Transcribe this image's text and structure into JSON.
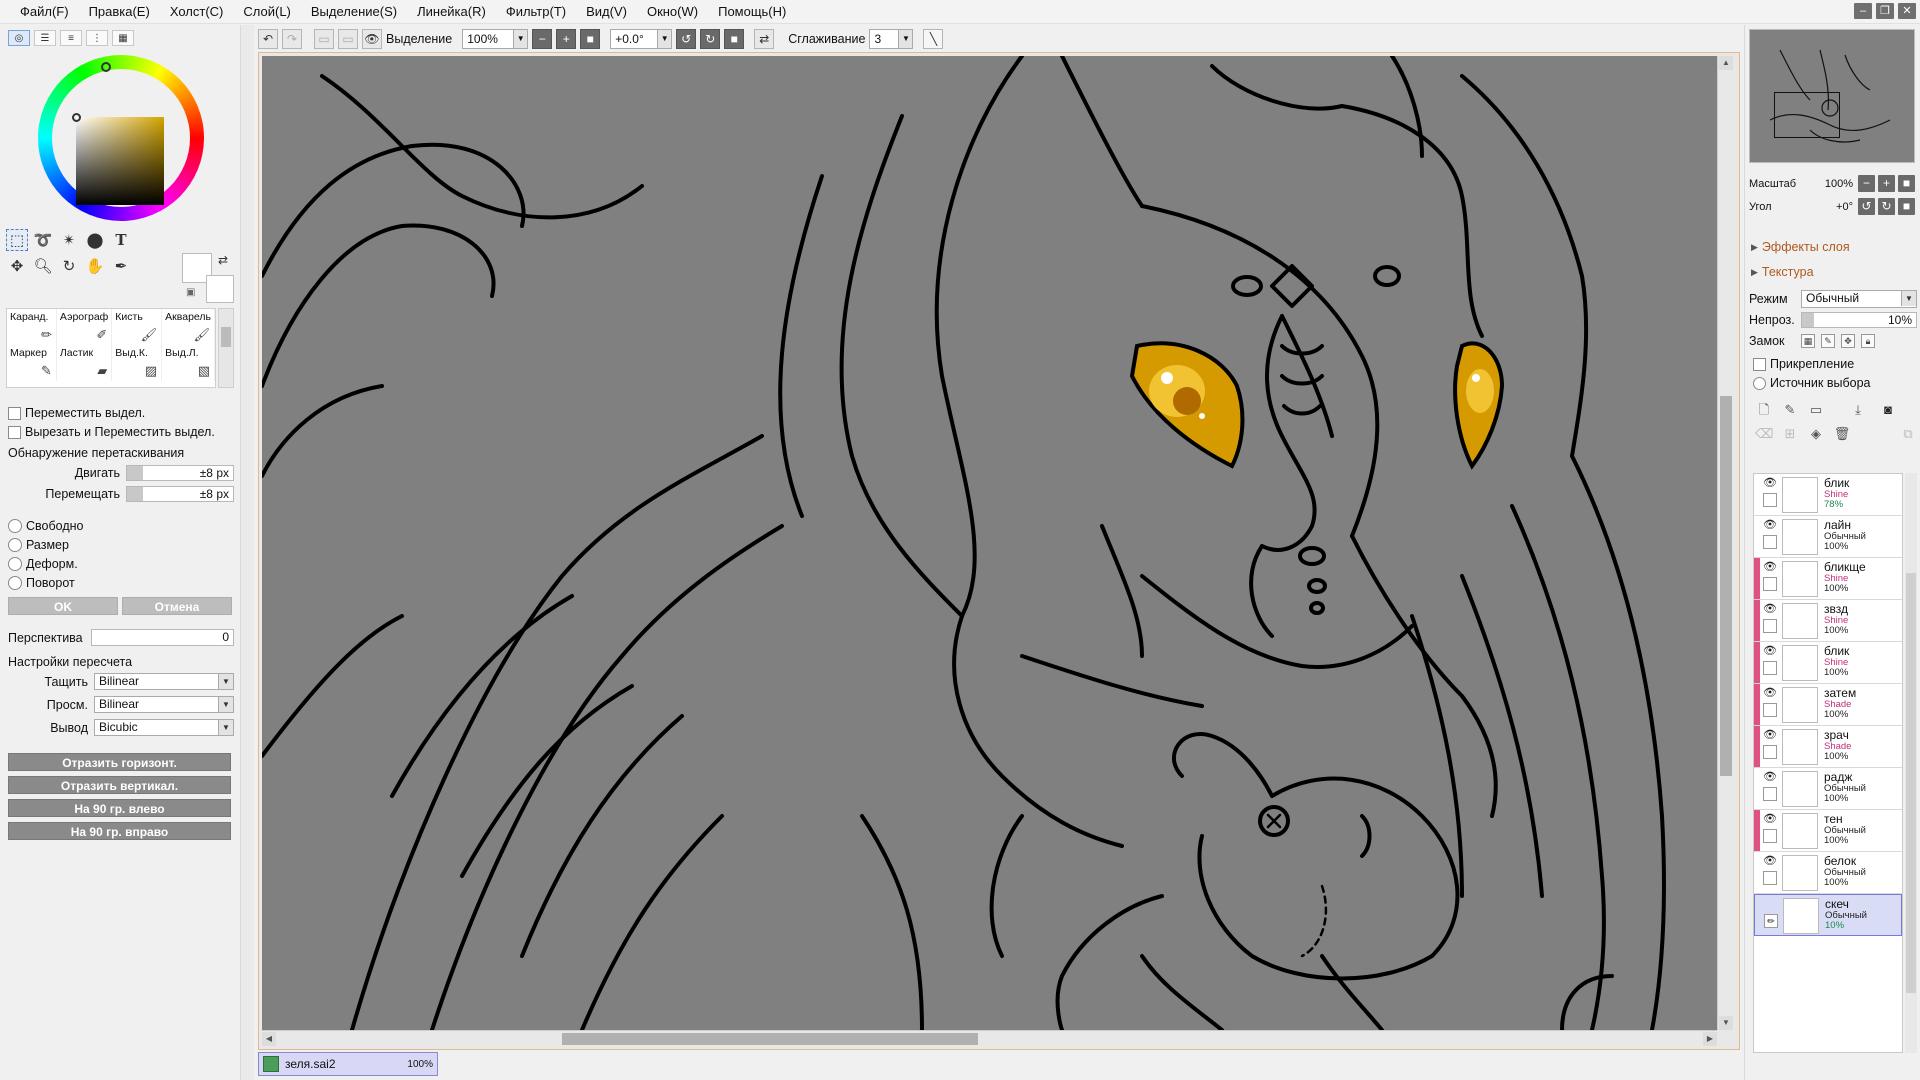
{
  "menubar": {
    "items": [
      "Файл(F)",
      "Правка(E)",
      "Холст(C)",
      "Слой(L)",
      "Выделение(S)",
      "Линейка(R)",
      "Фильтр(T)",
      "Вид(V)",
      "Окно(W)",
      "Помощь(H)"
    ]
  },
  "toolbar": {
    "selection_label": "Выделение",
    "zoom": "100%",
    "angle": "+0.0°",
    "smoothing_label": "Сглаживание",
    "smoothing_value": "3"
  },
  "tools": {
    "text_tool_glyph": "T"
  },
  "brushes": [
    {
      "label": "Каранд.",
      "icon": "pencil-icon"
    },
    {
      "label": "Аэрограф",
      "icon": "airbrush-icon"
    },
    {
      "label": "Кисть",
      "icon": "brush-icon"
    },
    {
      "label": "Акварель",
      "icon": "watercolor-icon"
    },
    {
      "label": "Маркер",
      "icon": "marker-icon"
    },
    {
      "label": "Ластик",
      "icon": "eraser-icon"
    },
    {
      "label": "Выд.К.",
      "icon": "select-pen-icon"
    },
    {
      "label": "Выд.Л.",
      "icon": "select-eraser-icon"
    }
  ],
  "transform": {
    "move_selection": "Переместить выдел.",
    "cut_move_selection": "Вырезать и Переместить выдел.",
    "drag_detection_title": "Обнаружение перетаскивания",
    "move_label": "Двигать",
    "move_value": "±8 px",
    "shift_label": "Перемещать",
    "shift_value": "±8 px",
    "radio_free": "Свободно",
    "radio_size": "Размер",
    "radio_deform": "Деформ.",
    "radio_rotate": "Поворот",
    "ok": "OK",
    "cancel": "Отмена",
    "perspective_label": "Перспектива",
    "perspective_value": "0",
    "resample_title": "Настройки пересчета",
    "drag_label": "Тащить",
    "drag_value": "Bilinear",
    "preview_label": "Просм.",
    "preview_value": "Bilinear",
    "output_label": "Вывод",
    "output_value": "Bicubic",
    "flip_h": "Отразить горизонт.",
    "flip_v": "Отразить вертикал.",
    "rot_left": "На 90 гр. влево",
    "rot_right": "На 90 гр. вправо"
  },
  "document_tab": {
    "name": "зеля.sai2",
    "zoom": "100%"
  },
  "navigator": {
    "scale_label": "Масштаб",
    "scale_value": "100%",
    "angle_label": "Угол",
    "angle_value": "+0°"
  },
  "layer_panel": {
    "effects_label": "Эффекты слоя",
    "texture_label": "Текстура",
    "mode_label": "Режим",
    "mode_value": "Обычный",
    "opacity_label": "Непроз.",
    "opacity_value": "10%",
    "lock_label": "Замок",
    "clipping_label": "Прикрепление",
    "selection_source_label": "Источник выбора"
  },
  "layers": [
    {
      "name": "блик",
      "mode": "Shine",
      "opacity": "78%",
      "clipped": false,
      "selected": false,
      "mode_color": "#c0307a",
      "op_color": "#1a8a4a"
    },
    {
      "name": "лайн",
      "mode": "Обычный",
      "opacity": "100%",
      "clipped": false,
      "selected": false,
      "mode_color": "#222222",
      "op_color": "#222222"
    },
    {
      "name": "бликще",
      "mode": "Shine",
      "opacity": "100%",
      "clipped": true,
      "selected": false,
      "mode_color": "#c0307a",
      "op_color": "#222222"
    },
    {
      "name": "звзд",
      "mode": "Shine",
      "opacity": "100%",
      "clipped": true,
      "selected": false,
      "mode_color": "#c0307a",
      "op_color": "#222222"
    },
    {
      "name": "блик",
      "mode": "Shine",
      "opacity": "100%",
      "clipped": true,
      "selected": false,
      "mode_color": "#c0307a",
      "op_color": "#222222"
    },
    {
      "name": "затем",
      "mode": "Shade",
      "opacity": "100%",
      "clipped": true,
      "selected": false,
      "mode_color": "#c0307a",
      "op_color": "#222222"
    },
    {
      "name": "зрач",
      "mode": "Shade",
      "opacity": "100%",
      "clipped": true,
      "selected": false,
      "mode_color": "#c0307a",
      "op_color": "#222222"
    },
    {
      "name": "радж",
      "mode": "Обычный",
      "opacity": "100%",
      "clipped": false,
      "selected": false,
      "mode_color": "#222222",
      "op_color": "#222222"
    },
    {
      "name": "тен",
      "mode": "Обычный",
      "opacity": "100%",
      "clipped": true,
      "selected": false,
      "mode_color": "#222222",
      "op_color": "#222222"
    },
    {
      "name": "белок",
      "mode": "Обычный",
      "opacity": "100%",
      "clipped": false,
      "selected": false,
      "mode_color": "#222222",
      "op_color": "#222222"
    },
    {
      "name": "скеч",
      "mode": "Обычный",
      "opacity": "10%",
      "clipped": false,
      "selected": true,
      "mode_color": "#222222",
      "op_color": "#1a8a4a"
    }
  ],
  "colors": {
    "clip_bar": "#e05080",
    "accent": "#7a7ad8",
    "canvas_bg": "#808080"
  }
}
